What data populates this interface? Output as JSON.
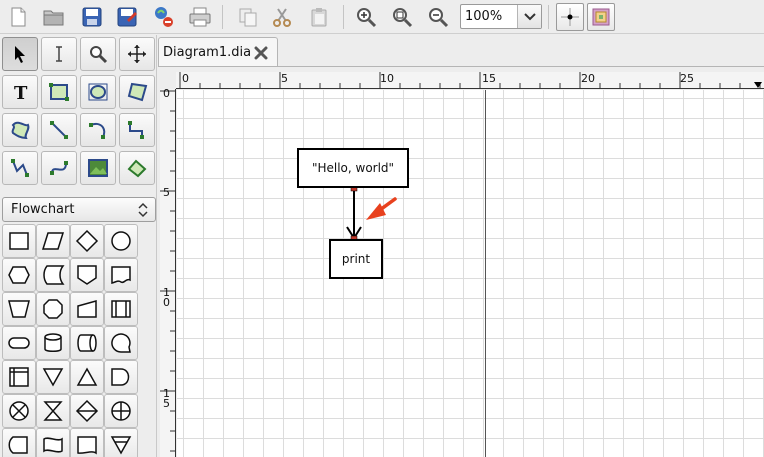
{
  "toolbar": {
    "zoom": "100%",
    "buttons": [
      "new-file-icon",
      "open-folder-icon",
      "save-icon",
      "save-as-icon",
      "export-icon",
      "print-icon",
      "copy-icon",
      "cut-icon",
      "paste-icon",
      "zoom-in-icon",
      "zoom-fit-icon",
      "zoom-out-icon"
    ]
  },
  "toolbox": {
    "tools": [
      "pointer-icon",
      "text-cursor-icon",
      "magnify-icon",
      "move-icon",
      "text-tool-icon",
      "box-tool-icon",
      "ellipse-tool-icon",
      "polygon-tool-icon",
      "beziergon-tool-icon",
      "line-tool-icon",
      "arc-tool-icon",
      "zigzag-tool-icon",
      "polyline-tool-icon",
      "bezier-tool-icon",
      "image-tool-icon",
      "outline-tool-icon"
    ],
    "sheet": "Flowchart"
  },
  "document": {
    "tab_label": "Diagram1.dia"
  },
  "ruler": {
    "h_ticks": [
      "0",
      "5",
      "10",
      "15",
      "20",
      "25"
    ],
    "v_ticks": [
      "0",
      "5",
      "1\n0",
      "1\n5"
    ]
  },
  "diagram": {
    "node1": "\"Hello, world\"",
    "node2": "print"
  },
  "colors": {
    "annotation_arrow": "#e8411e",
    "grid": "#dcdcdc",
    "connection_point": "#b03030"
  }
}
